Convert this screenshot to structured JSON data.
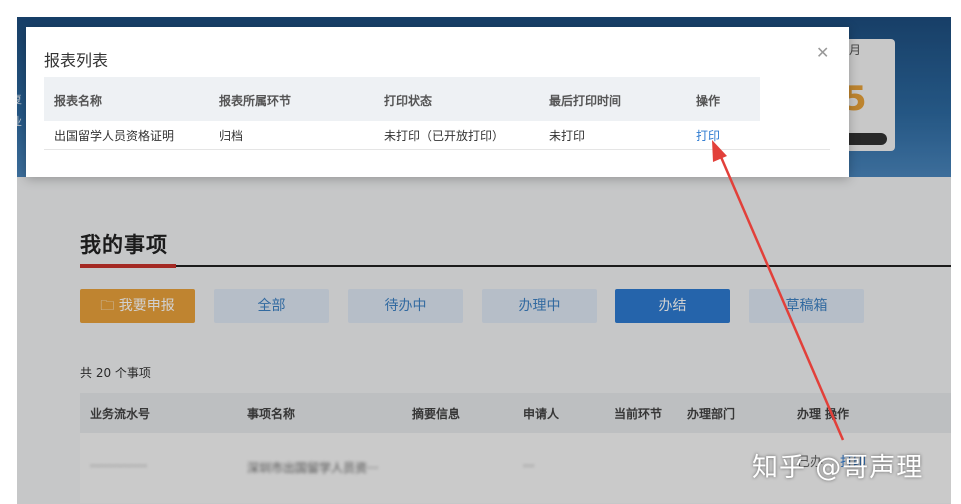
{
  "banner": {
    "month_label": "月",
    "big_digit": "5",
    "left_fragments": [
      "/",
      "复",
      "业"
    ]
  },
  "content": {
    "section_title": "我的事项",
    "tabs": [
      {
        "label": "我要申报",
        "icon": "folder-icon"
      },
      {
        "label": "全部"
      },
      {
        "label": "待办中"
      },
      {
        "label": "办理中"
      },
      {
        "label": "办结"
      },
      {
        "label": "草稿箱"
      }
    ],
    "count_text": "共 20 个事项",
    "grid_headers": [
      "业务流水号",
      "事项名称",
      "摘要信息",
      "申请人",
      "当前环节",
      "办理部门",
      "办理",
      "操作"
    ],
    "grid_row": {
      "serial": "···············",
      "name": "深圳市出国留学人员资···",
      "applicant": "···",
      "status": "已办",
      "action": "打印"
    }
  },
  "modal": {
    "title": "报表列表",
    "headers": [
      "报表名称",
      "报表所属环节",
      "打印状态",
      "最后打印时间",
      "操作"
    ],
    "rows": [
      {
        "name": "出国留学人员资格证明",
        "stage": "归档",
        "print_status": "未打印（已开放打印）",
        "last_print_time": "未打印",
        "action": "打印"
      }
    ]
  },
  "watermark": "知乎 @哥声理",
  "colors": {
    "accent": "#2e7bd1",
    "orange": "#e9a23b",
    "annotation": "#e2403a"
  }
}
